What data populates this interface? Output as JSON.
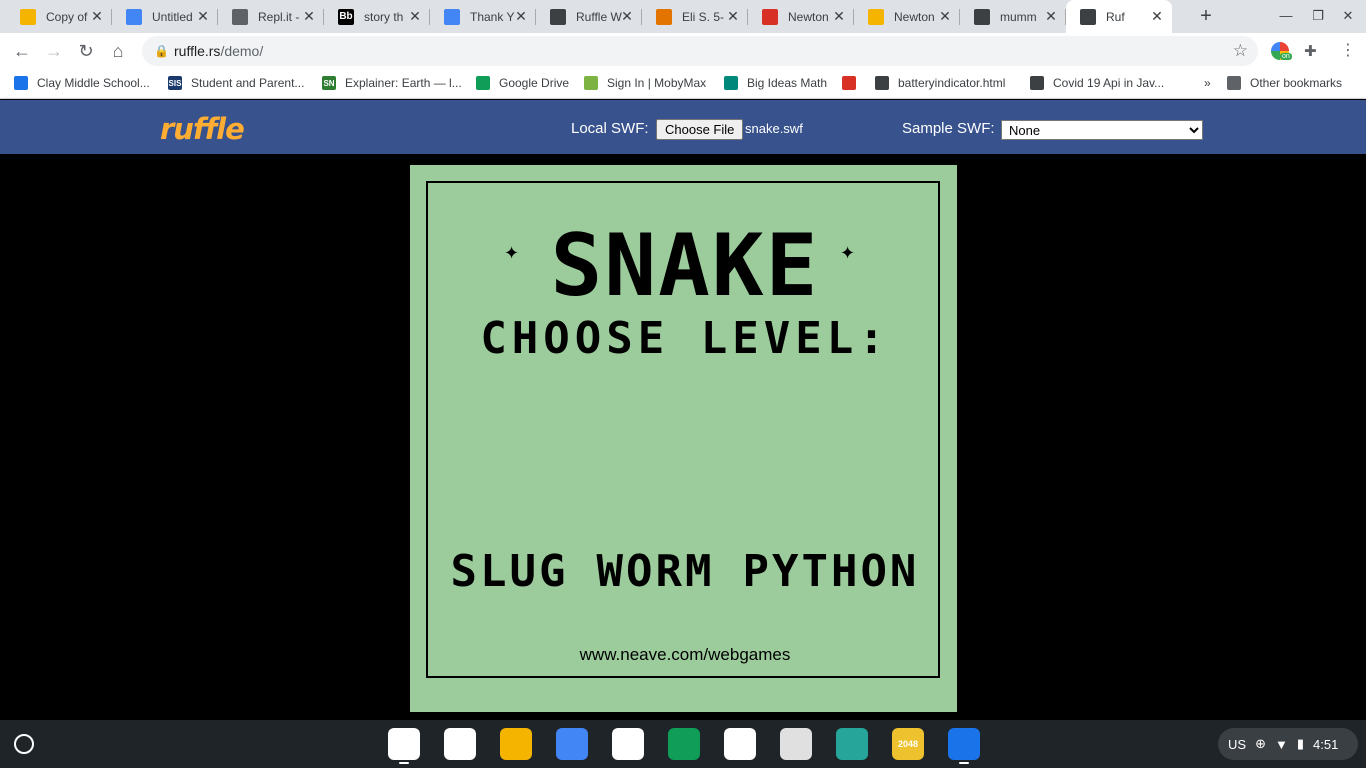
{
  "tabs": [
    {
      "title": "Copy of",
      "icon": "slides-icon",
      "color": "#f4b400"
    },
    {
      "title": "Untitled",
      "icon": "docs-icon",
      "color": "#4285f4"
    },
    {
      "title": "Repl.it -",
      "icon": "replit-icon",
      "color": "#5f6368"
    },
    {
      "title": "story th",
      "icon": "blackboard-icon",
      "color": "#000000",
      "glyph": "Bb"
    },
    {
      "title": "Thank Y",
      "icon": "docs-icon",
      "color": "#4285f4"
    },
    {
      "title": "Ruffle W",
      "icon": "globe-icon",
      "color": "#3c4043"
    },
    {
      "title": "Eli S. 5-",
      "icon": "puzzle-icon",
      "color": "#e37400"
    },
    {
      "title": "Newton",
      "icon": "newton-icon",
      "color": "#d93025"
    },
    {
      "title": "Newton",
      "icon": "slides-icon",
      "color": "#f4b400"
    },
    {
      "title": "mumm",
      "icon": "globe-icon",
      "color": "#3c4043"
    },
    {
      "title": "Ruf",
      "icon": "globe-icon",
      "color": "#3c4043",
      "active": true
    }
  ],
  "toolbar": {
    "url_host": "ruffle.rs",
    "url_path": "/demo/"
  },
  "bookmarks": [
    {
      "label": "Clay Middle School...",
      "icon": "clay-icon",
      "color": "#1a73e8"
    },
    {
      "label": "Student and Parent...",
      "icon": "sis-icon",
      "color": "#1b3a6b",
      "glyph": "SIS"
    },
    {
      "label": "Explainer: Earth — l...",
      "icon": "sn-icon",
      "color": "#2e7d32",
      "glyph": "SN"
    },
    {
      "label": "Google Drive",
      "icon": "drive-icon",
      "color": "#0f9d58"
    },
    {
      "label": "Sign In | MobyMax",
      "icon": "mobymax-icon",
      "color": "#7cb342"
    },
    {
      "label": "Big Ideas Math",
      "icon": "bigideas-icon",
      "color": "#00897b"
    },
    {
      "label": "",
      "icon": "newton-icon",
      "color": "#d93025"
    },
    {
      "label": "batteryindicator.html",
      "icon": "globe-icon",
      "color": "#3c4043"
    },
    {
      "label": "Covid 19 Api in Jav...",
      "icon": "globe-icon",
      "color": "#3c4043"
    }
  ],
  "bookmarks_more": "»",
  "other_bookmarks": "Other bookmarks",
  "ruffle": {
    "logo": "ruffle",
    "local_swf_label": "Local SWF:",
    "choose_file_label": "Choose File",
    "file_name": "snake.swf",
    "sample_swf_label": "Sample SWF:",
    "sample_selected": "None"
  },
  "game": {
    "title": "SNAKE",
    "subtitle": "CHOOSE LEVEL:",
    "levels": [
      "SLUG",
      "WORM",
      "PYTHON"
    ],
    "url": "www.neave.com/webgames"
  },
  "shelf": {
    "apps": [
      {
        "name": "chrome-app",
        "color": "#ffffff"
      },
      {
        "name": "drive-app",
        "color": "#ffffff"
      },
      {
        "name": "slides-app",
        "color": "#f4b400"
      },
      {
        "name": "docs-app",
        "color": "#4285f4"
      },
      {
        "name": "photos-app",
        "color": "#ffffff"
      },
      {
        "name": "sheets-app",
        "color": "#0f9d58"
      },
      {
        "name": "wikipedia-app",
        "color": "#ffffff"
      },
      {
        "name": "notes-app",
        "color": "#e0e0e0"
      },
      {
        "name": "clipboard-app",
        "color": "#26a69a"
      },
      {
        "name": "2048-app",
        "color": "#edc22e",
        "glyph": "2048"
      },
      {
        "name": "files-app",
        "color": "#1a73e8"
      }
    ],
    "locale": "US",
    "time": "4:51"
  }
}
